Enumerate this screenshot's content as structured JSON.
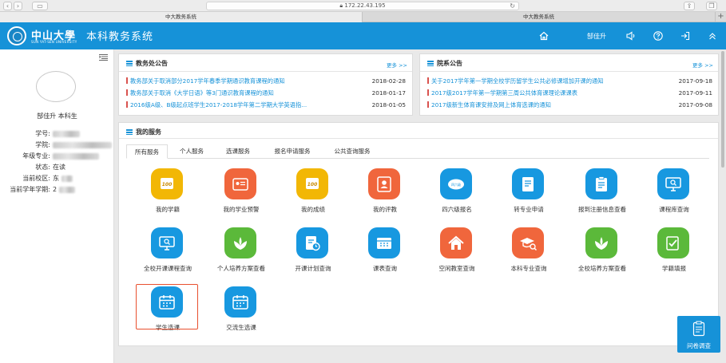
{
  "browser": {
    "url": "172.22.43.195",
    "tabs": [
      "中大教务系统",
      "中大教务系统"
    ]
  },
  "header": {
    "logo_cn": "中山大學",
    "logo_en": "SUN YAT-SEN UNIVERSITY",
    "title": "本科教务系统",
    "user": "郜佳升"
  },
  "sidebar": {
    "user_name": "郜佳升 本科生",
    "fields": [
      {
        "label": "学号:",
        "value": ""
      },
      {
        "label": "学院:",
        "value": ""
      },
      {
        "label": "年级专业:",
        "value": ""
      },
      {
        "label": "状态:",
        "value": "在读"
      },
      {
        "label": "当前校区:",
        "value": "东"
      },
      {
        "label": "当前学年学期:",
        "value": "2"
      }
    ]
  },
  "office_notices": {
    "title": "教务处公告",
    "more": "更多 >>",
    "items": [
      {
        "text": "教务部关于取消部分2017学年春季学期通识教育课程的通知",
        "date": "2018-02-28"
      },
      {
        "text": "教务部关于取消《大学日语》等3门通识教育课程的通知",
        "date": "2018-01-17"
      },
      {
        "text": "2016级A级、B级起点班学生2017-2018学年第二学期大学英语指...",
        "date": "2018-01-05"
      }
    ]
  },
  "dept_notices": {
    "title": "院系公告",
    "more": "更多 >>",
    "items": [
      {
        "text": "关于2017学年第一学期全校学历留学生公共必修课增加开课的通知",
        "date": "2017-09-18"
      },
      {
        "text": "2017级2017学年第一学期第三周公共体育课理论课课表",
        "date": "2017-09-11"
      },
      {
        "text": "2017级新生体育课安排及网上体育选课的通知",
        "date": "2017-09-08"
      }
    ]
  },
  "services": {
    "title": "我的服务",
    "tabs": [
      "所有服务",
      "个人服务",
      "选课服务",
      "报名申请服务",
      "公共查询服务"
    ],
    "items": [
      {
        "label": "我的学籍",
        "icon": "100-score-icon",
        "color": "#f2b705"
      },
      {
        "label": "我的学业预警",
        "icon": "id-card-icon",
        "color": "#f0663c"
      },
      {
        "label": "我的成绩",
        "icon": "100-score-icon",
        "color": "#f2b705"
      },
      {
        "label": "我的评教",
        "icon": "user-card-icon",
        "color": "#f0663c"
      },
      {
        "label": "四六级报名",
        "icon": "cet-badge-icon",
        "color": "#1798e0"
      },
      {
        "label": "转专业申请",
        "icon": "document-icon",
        "color": "#1798e0"
      },
      {
        "label": "报到注册信息查看",
        "icon": "clipboard-icon",
        "color": "#1798e0"
      },
      {
        "label": "课程库查询",
        "icon": "monitor-search-icon",
        "color": "#1798e0"
      },
      {
        "label": "全校开课课程查询",
        "icon": "monitor-search-icon",
        "color": "#1798e0"
      },
      {
        "label": "个人培养方案查看",
        "icon": "lotus-icon",
        "color": "#5bb93a"
      },
      {
        "label": "开课计划查询",
        "icon": "doc-clock-icon",
        "color": "#1798e0"
      },
      {
        "label": "课表查询",
        "icon": "timetable-icon",
        "color": "#1798e0"
      },
      {
        "label": "空闲教室查询",
        "icon": "home-icon",
        "color": "#f0663c"
      },
      {
        "label": "本科专业查询",
        "icon": "graduation-search-icon",
        "color": "#f0663c"
      },
      {
        "label": "全校培养方案查看",
        "icon": "lotus-icon",
        "color": "#5bb93a"
      },
      {
        "label": "学籍填报",
        "icon": "edit-check-icon",
        "color": "#5bb93a"
      },
      {
        "label": "学生选课",
        "icon": "calendar-icon",
        "color": "#1798e0"
      },
      {
        "label": "交流生选课",
        "icon": "calendar-icon",
        "color": "#1798e0"
      }
    ]
  },
  "survey": {
    "label": "问卷调查"
  }
}
